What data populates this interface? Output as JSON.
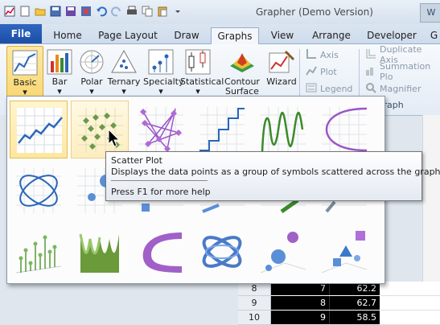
{
  "window": {
    "title": "Grapher (Demo Version)",
    "corner_label": "W"
  },
  "tabs": [
    {
      "label": "File"
    },
    {
      "label": "Home"
    },
    {
      "label": "Page Layout"
    },
    {
      "label": "Draw"
    },
    {
      "label": "Graphs"
    },
    {
      "label": "View"
    },
    {
      "label": "Arrange"
    },
    {
      "label": "Developer"
    },
    {
      "label": "G"
    }
  ],
  "ribbon": {
    "buttons": [
      {
        "label": "Basic",
        "icon": "basic-line-chart-icon"
      },
      {
        "label": "Bar",
        "icon": "bar-chart-icon"
      },
      {
        "label": "Polar",
        "icon": "polar-chart-icon"
      },
      {
        "label": "Ternary",
        "icon": "ternary-chart-icon"
      },
      {
        "label": "Specialty",
        "icon": "specialty-chart-icon"
      },
      {
        "label": "Statistical",
        "icon": "statistical-chart-icon"
      },
      {
        "label": "Contour",
        "label2": "Surface",
        "icon": "contour-surface-icon"
      },
      {
        "label": "Wizard",
        "icon": "wizard-icon"
      }
    ],
    "small_left": [
      {
        "label": "Axis",
        "icon": "axis-icon"
      },
      {
        "label": "Plot",
        "icon": "plot-icon"
      },
      {
        "label": "Legend",
        "icon": "legend-icon"
      }
    ],
    "small_right": [
      {
        "label": "Duplicate Axis",
        "icon": "duplicate-axis-icon"
      },
      {
        "label": "Summation Plo",
        "icon": "summation-plot-icon"
      },
      {
        "label": "Magnifier",
        "icon": "magnifier-icon"
      }
    ],
    "group_label": "Graph"
  },
  "gallery": {
    "items": [
      {
        "name": "line-plot"
      },
      {
        "name": "scatter-plot"
      },
      {
        "name": "line-scatter-plot"
      },
      {
        "name": "step-plot"
      },
      {
        "name": "function-plot"
      },
      {
        "name": "polyline-curve-plot"
      },
      {
        "name": "lissajous-plot"
      },
      {
        "name": "bubble-plot"
      },
      {
        "name": "3d-ribbon-plot"
      },
      {
        "name": "3d-wall-plot"
      },
      {
        "name": "3d-curve-plot"
      },
      {
        "name": "3d-lissajous-plot"
      },
      {
        "name": "3d-bubble-plot"
      },
      {
        "name": "3d-shapes-plot"
      }
    ]
  },
  "tooltip": {
    "title": "Scatter Plot",
    "description": "Displays the data points as a group of symbols scattered across the graph",
    "help": "Press F1 for more help"
  },
  "sheet": {
    "rows": [
      {
        "row": "8",
        "a": "7",
        "b": "62.2"
      },
      {
        "row": "9",
        "a": "8",
        "b": "62.7"
      },
      {
        "row": "10",
        "a": "9",
        "b": "58.5"
      }
    ]
  }
}
